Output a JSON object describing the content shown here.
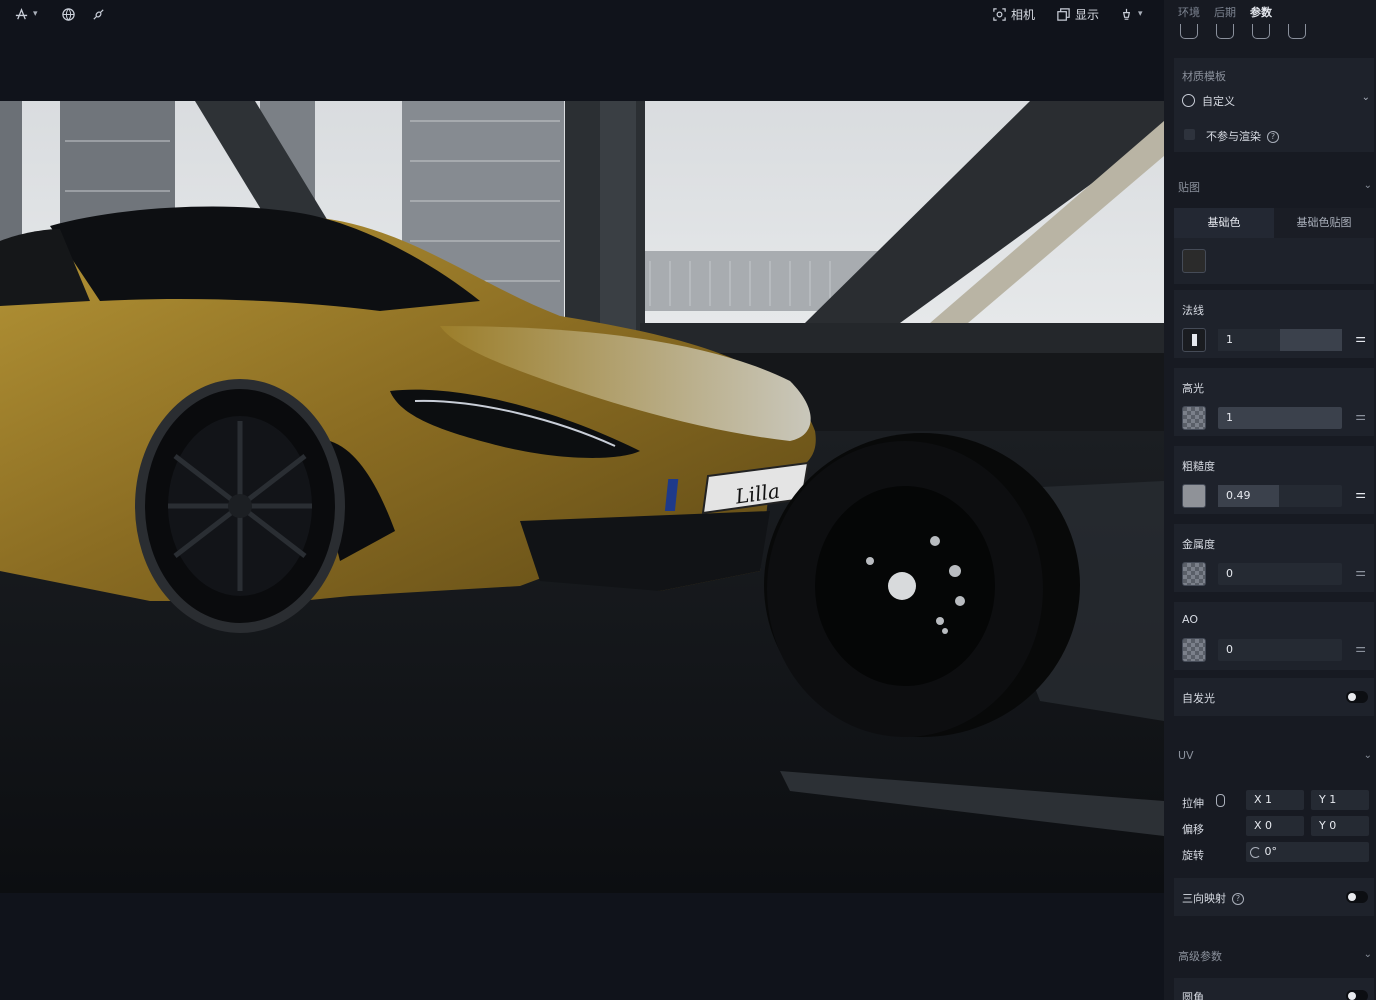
{
  "toolbar": {
    "camera_label": "相机",
    "display_label": "显示"
  },
  "viewport": {
    "plate_text": "Lilla"
  },
  "panel": {
    "tabs": [
      "环境",
      "后期",
      "参数"
    ],
    "active_tab": "参数",
    "material_template": {
      "title": "材质模板",
      "selected": "自定义",
      "exclude_render_label": "不参与渲染"
    },
    "maps": {
      "title": "贴图",
      "subtabs": [
        "基础色",
        "基础色贴图"
      ],
      "base_color": "#2b2b2b"
    },
    "normal": {
      "label": "法线",
      "value": "1"
    },
    "specular": {
      "label": "高光",
      "value": "1"
    },
    "roughness": {
      "label": "粗糙度",
      "value": "0.49",
      "fraction": 0.49
    },
    "metallic": {
      "label": "金属度",
      "value": "0"
    },
    "ao": {
      "label": "AO",
      "value": "0"
    },
    "emissive": {
      "label": "自发光",
      "enabled": false
    },
    "uv": {
      "title": "UV",
      "stretch_label": "拉伸",
      "stretch_x": "X 1",
      "stretch_y": "Y 1",
      "offset_label": "偏移",
      "offset_x": "X 0",
      "offset_y": "Y 0",
      "rotate_label": "旋转",
      "rotate_value": "0°"
    },
    "triplanar": {
      "label": "三向映射",
      "enabled": false
    },
    "advanced": {
      "title": "高级参数",
      "fillet_label": "圆角"
    }
  },
  "colors": {
    "app_bg": "#10131b",
    "panel_bg": "#171a22",
    "card_bg": "#1e222b",
    "car_gold": "#9c7e2a"
  }
}
